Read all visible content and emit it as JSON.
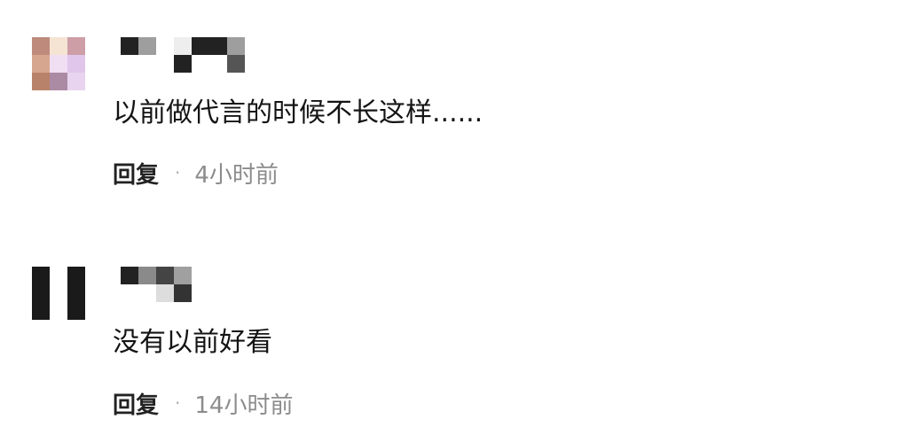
{
  "comments": [
    {
      "avatar_colors": [
        "#bd8a7c",
        "#f5e4d3",
        "#cd9ea6",
        "#d6a68e",
        "#f0def2",
        "#e0c6ea",
        "#b8826a",
        "#ab8aa4",
        "#e8d4ee"
      ],
      "username_colors": [
        "#222222",
        "#9e9e9e",
        "#ffffff",
        "#eeeeee",
        "#222222",
        "#222222",
        "#9e9e9e",
        "#ffffff",
        "#ffffff",
        "#ffffff",
        "#222222",
        "#ffffff",
        "#ffffff",
        "#555555"
      ],
      "text": "以前做代言的时候不长这样......",
      "reply_label": "回复",
      "separator": "·",
      "time": "4小时前"
    },
    {
      "avatar_colors": [
        "#1a1a1a",
        "#ffffff",
        "#1a1a1a",
        "#1a1a1a",
        "#ffffff",
        "#1a1a1a",
        "#1a1a1a",
        "#ffffff",
        "#1a1a1a"
      ],
      "username_colors": [
        "#222222",
        "#8a8a8a",
        "#444444",
        "#a0a0a0",
        "#ffffff",
        "#ffffff",
        "#ffffff",
        "#ffffff",
        "#ffffff",
        "#dddddd",
        "#333333",
        "#ffffff",
        "#ffffff",
        "#ffffff"
      ],
      "text": "没有以前好看",
      "reply_label": "回复",
      "separator": "·",
      "time": "14小时前"
    }
  ]
}
